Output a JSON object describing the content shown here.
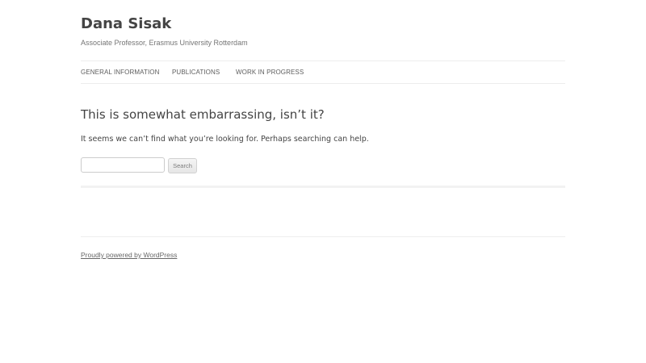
{
  "site": {
    "title": "Dana Sisak",
    "description": "Associate Professor, Erasmus University Rotterdam"
  },
  "nav": {
    "items": [
      {
        "label": "GENERAL INFORMATION"
      },
      {
        "label": "PUBLICATIONS"
      },
      {
        "label": "WORK IN PROGRESS"
      }
    ]
  },
  "content": {
    "title": "This is somewhat embarrassing, isn’t it?",
    "message": "It seems we can’t find what you’re looking for. Perhaps searching can help.",
    "search": {
      "value": "",
      "button_label": "Search"
    }
  },
  "footer": {
    "credit_link": "Proudly powered by WordPress"
  },
  "colors": {
    "text": "#444444",
    "muted": "#757575",
    "border": "#ededed"
  }
}
